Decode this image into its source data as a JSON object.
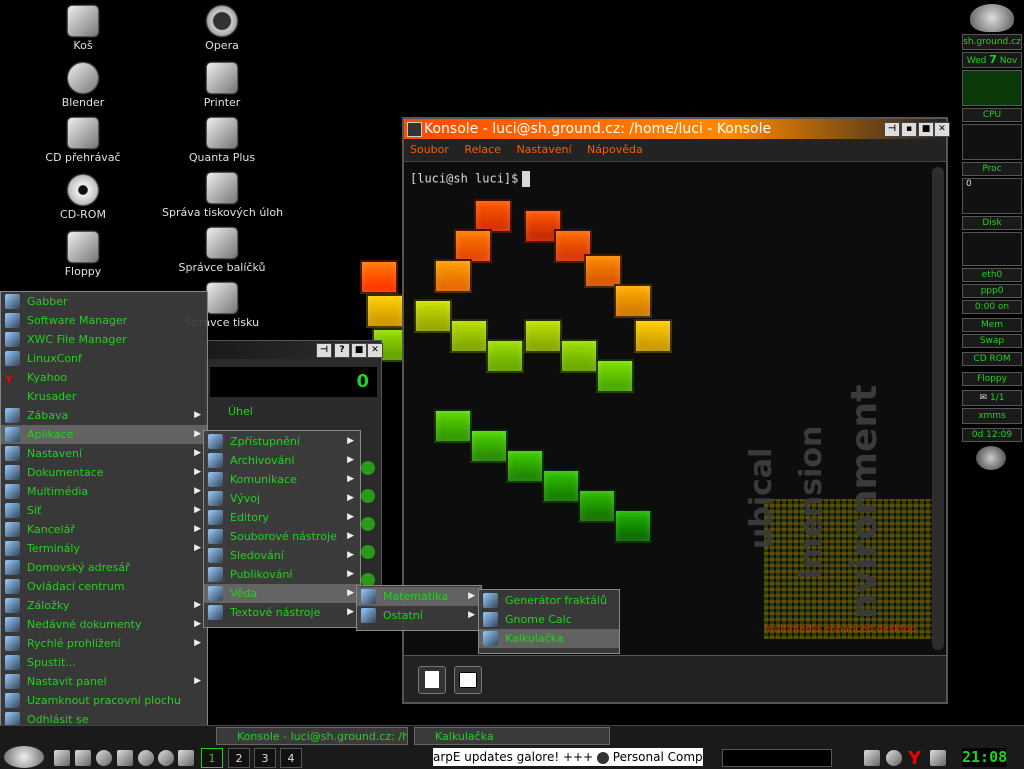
{
  "desktop_icons": [
    {
      "label": "Koš",
      "icon": "trash-icon"
    },
    {
      "label": "Opera",
      "icon": "opera-icon"
    },
    {
      "label": "Blender",
      "icon": "blender-icon"
    },
    {
      "label": "Printer",
      "icon": "printer-icon"
    },
    {
      "label": "CD přehrávač",
      "icon": "cd-player-icon"
    },
    {
      "label": "Quanta Plus",
      "icon": "quanta-icon"
    },
    {
      "label": "CD-ROM",
      "icon": "cdrom-icon"
    },
    {
      "label": "Správa tiskových úloh",
      "icon": "print-jobs-icon"
    },
    {
      "label": "Floppy",
      "icon": "floppy-icon"
    },
    {
      "label": "Správce balíčků",
      "icon": "package-manager-icon"
    },
    {
      "label": "Správce tisku",
      "icon": "print-manager-icon"
    }
  ],
  "wallpaper": {
    "text1": "ubical",
    "text2": "imension",
    "text3": "nvironment",
    "tagline": "multimedia enhanced desktop"
  },
  "konsole": {
    "title": "Konsole - luci@sh.ground.cz: /home/luci - Konsole",
    "menu": [
      "Soubor",
      "Relace",
      "Nastavení",
      "Nápověda"
    ],
    "prompt": "[luci@sh luci]$"
  },
  "calculator": {
    "display": "0",
    "angle_label": "Úhel"
  },
  "kmenu": {
    "items": [
      {
        "label": "Gabber",
        "submenu": false
      },
      {
        "label": "Software Manager",
        "submenu": false
      },
      {
        "label": "XWC File Manager",
        "submenu": false
      },
      {
        "label": "LinuxConf",
        "submenu": false
      },
      {
        "label": "Kyahoo",
        "submenu": false
      },
      {
        "label": "Krusader",
        "submenu": false
      },
      {
        "label": "Zábava",
        "submenu": true
      },
      {
        "label": "Aplikace",
        "submenu": true
      },
      {
        "label": "Nastavení",
        "submenu": true
      },
      {
        "label": "Dokumentace",
        "submenu": true
      },
      {
        "label": "Multimédia",
        "submenu": true
      },
      {
        "label": "Síť",
        "submenu": true
      },
      {
        "label": "Kancelář",
        "submenu": true
      },
      {
        "label": "Terminály",
        "submenu": true
      },
      {
        "label": "Domovský adresář",
        "submenu": false
      },
      {
        "label": "Ovládací centrum",
        "submenu": false
      },
      {
        "label": "Záložky",
        "submenu": true
      },
      {
        "label": "Nedávné dokumenty",
        "submenu": true
      },
      {
        "label": "Rychlé prohlížení",
        "submenu": true
      },
      {
        "label": "Spustit...",
        "submenu": false
      },
      {
        "label": "Nastavit panel",
        "submenu": true
      },
      {
        "label": "Uzamknout pracovní plochu",
        "submenu": false
      },
      {
        "label": "Odhlásit se",
        "submenu": false
      }
    ]
  },
  "submenu_aplikace": [
    "Zpřístupnění",
    "Archivování",
    "Komunikace",
    "Vývoj",
    "Editory",
    "Souborové nástroje",
    "Sledování",
    "Publikování",
    "Věda",
    "Textové nástroje"
  ],
  "submenu_veda": [
    "Matematika",
    "Ostatní"
  ],
  "submenu_matematika": [
    "Generátor fraktálů",
    "Gnome Calc",
    "Kalkulačka"
  ],
  "taskbar": {
    "tasks": [
      "Konsole - luci@sh.ground.cz: /hom",
      "Kalkulačka"
    ],
    "desktops": [
      "1",
      "2",
      "3",
      "4"
    ],
    "ticker": "arpE updates galore! +++",
    "ticker_link": "Personal Computer",
    "clock": "21:08"
  },
  "monitor": {
    "host": "sh.ground.cz",
    "date_day": "Wed",
    "date_num": "7",
    "date_month": "Nov",
    "cpu": "CPU",
    "proc": "Proc",
    "proc_value": "0",
    "disk": "Disk",
    "eth": "eth0",
    "ppp": "ppp0",
    "net_time": "0:00 on",
    "mem": "Mem",
    "swap": "Swap",
    "cdrom": "CD ROM",
    "floppy": "Floppy",
    "mail": "1/1",
    "xmms": "xmms",
    "uptime": "0d 12:09"
  },
  "colors": {
    "accent_green": "#22d11f",
    "title_orange": "#ff4a00"
  }
}
